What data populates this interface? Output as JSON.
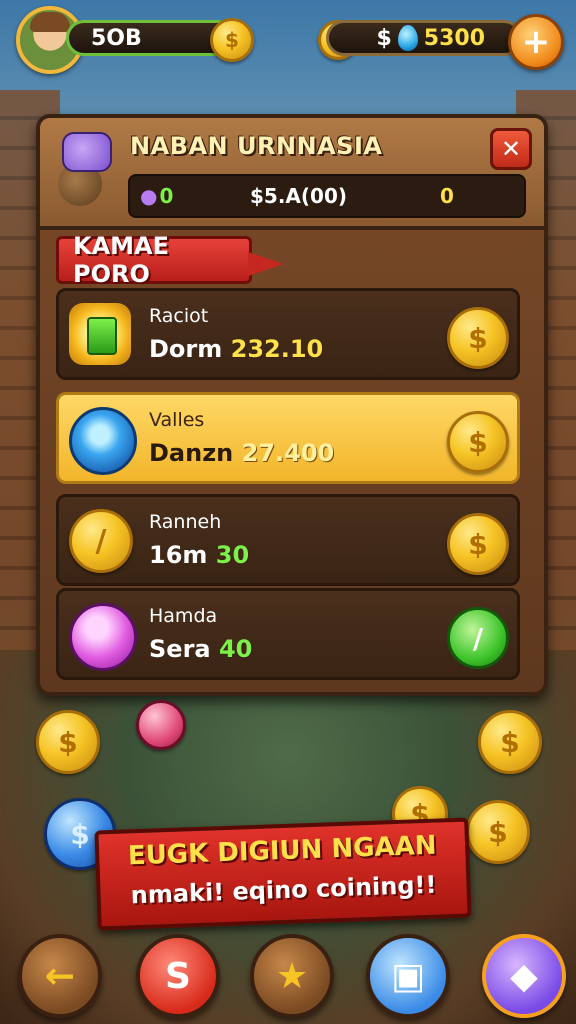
{
  "top_bar": {
    "left_value": "5OB",
    "right_prefix": "$",
    "right_value": "5300",
    "plus_label": "+"
  },
  "panel": {
    "title": "NABAN URNNASIA",
    "close_label": "✕",
    "stat_1": "0",
    "stat_2": "$5.A(00)",
    "stat_3": "0",
    "section_label": "KAMAE PORO",
    "items": [
      {
        "name": "Raciot",
        "detail_text": "Dorm",
        "amount": "232.10",
        "icon": "green-gem-badge-icon"
      },
      {
        "name": "Valles",
        "detail_text": "Danzn",
        "amount": "27.400",
        "icon": "blue-token-icon"
      },
      {
        "name": "Ranneh",
        "detail_text": "16m",
        "amount": "30",
        "icon": "gold-coin-icon"
      },
      {
        "name": "Hamda",
        "detail_text": "Sera",
        "amount": "40",
        "icon": "pink-orb-icon"
      }
    ]
  },
  "banner": {
    "line1": "EUGK DIGIUN NGAAN",
    "line2": "nmaki! eqino coining!!"
  },
  "coin_symbol": "$",
  "nav": [
    {
      "icon": "back-arrow-icon"
    },
    {
      "icon": "red-coin-icon"
    },
    {
      "icon": "star-icon"
    },
    {
      "icon": "shop-icon"
    },
    {
      "icon": "bonus-icon"
    }
  ]
}
